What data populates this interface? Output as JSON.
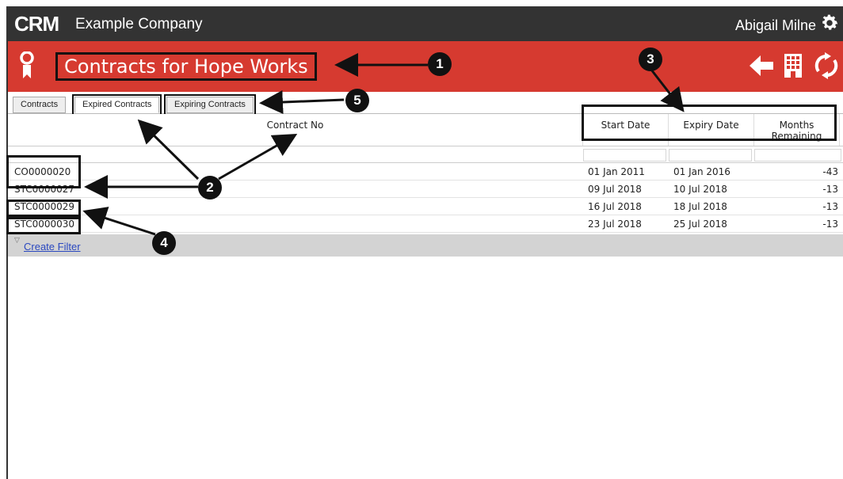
{
  "topbar": {
    "logo": "CRM",
    "company": "Example Company",
    "user": "Abigail Milne"
  },
  "header": {
    "title": "Contracts for Hope Works"
  },
  "tabs": [
    {
      "label": "Contracts"
    },
    {
      "label": "Expired Contracts"
    },
    {
      "label": "Expiring Contracts"
    }
  ],
  "table": {
    "columns": [
      "Contract No",
      "Start Date",
      "Expiry Date",
      "Months Remaining"
    ],
    "rows": [
      {
        "contract_no": "CO0000020",
        "start": "01 Jan 2011",
        "expiry": "01 Jan 2016",
        "months": "-43"
      },
      {
        "contract_no": "STC0000027",
        "start": "09 Jul 2018",
        "expiry": "10 Jul 2018",
        "months": "-13"
      },
      {
        "contract_no": "STC0000029",
        "start": "16 Jul 2018",
        "expiry": "18 Jul 2018",
        "months": "-13"
      },
      {
        "contract_no": "STC0000030",
        "start": "23 Jul 2018",
        "expiry": "25 Jul 2018",
        "months": "-13"
      }
    ]
  },
  "footer": {
    "create_filter": "Create Filter"
  },
  "callouts": [
    "1",
    "2",
    "3",
    "4",
    "5"
  ],
  "colors": {
    "topbar": "#333333",
    "header": "#d63a30",
    "link": "#3b4fc7"
  }
}
